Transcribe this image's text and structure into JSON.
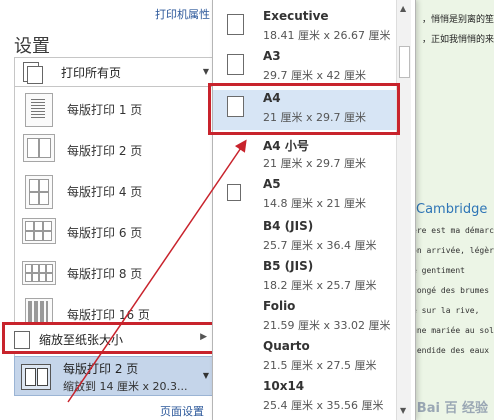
{
  "header": {
    "printer_properties": "打印机属性",
    "title": "设置"
  },
  "pages_select": {
    "label": "打印所有页"
  },
  "pages_per_sheet": [
    {
      "label": "每版打印 1 页"
    },
    {
      "label": "每版打印 2 页"
    },
    {
      "label": "每版打印 4 页"
    },
    {
      "label": "每版打印 6 页"
    },
    {
      "label": "每版打印 8 页"
    },
    {
      "label": "每版打印 16 页"
    }
  ],
  "scale_option": {
    "label": "缩放至纸张大小"
  },
  "current_setting": {
    "title": "每版打印 2 页",
    "subtitle": "缩放到 14 厘米 x 20.3..."
  },
  "page_setup_link": "页面设置",
  "paper_sizes": [
    {
      "name": "Executive",
      "dims": "18.41 厘米 x 26.67 厘米"
    },
    {
      "name": "A3",
      "dims": "29.7 厘米 x 42 厘米"
    },
    {
      "name": "A4",
      "dims": "21 厘米 x 29.7 厘米"
    },
    {
      "name": "A4 小号",
      "dims": "21 厘米 x 29.7 厘米"
    },
    {
      "name": "A5",
      "dims": "14.8 厘米 x 21 厘米"
    },
    {
      "name": "B4 (JIS)",
      "dims": "25.7 厘米 x 36.4 厘米"
    },
    {
      "name": "B5 (JIS)",
      "dims": "18.2 厘米 x 25.7 厘米"
    },
    {
      "name": "Folio",
      "dims": "21.59 厘米 x 33.02 厘米"
    },
    {
      "name": "Quarto",
      "dims": "21.5 厘米 x 27.5 厘米"
    },
    {
      "name": "10x14",
      "dims": "25.4 厘米 x 35.56 厘米"
    }
  ],
  "document_preview": {
    "line1": "，悄悄是别离的笙箫",
    "line2": "，正如我悄悄的来",
    "heading": "Cambridge",
    "french": [
      "ère est ma démarche",
      "on arrivée, légère",
      "e gentiment",
      "congé des brumes",
      "é sur la rive,",
      "une mariée au soleil",
      "lendide des eaux"
    ]
  },
  "watermark": "Bai 百 经验",
  "colors": {
    "highlight_red": "#c8232c",
    "selection_blue": "#c5d5ea",
    "link_blue": "#2b579a",
    "doc_bg": "#ecf5e6"
  }
}
